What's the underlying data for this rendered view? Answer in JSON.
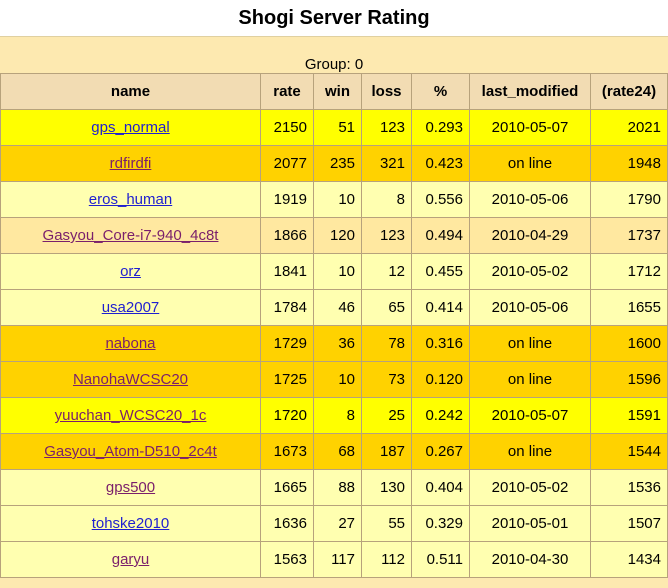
{
  "page": {
    "title": "Shogi Server Rating",
    "group_caption": "Group: 0"
  },
  "table": {
    "headers": {
      "name": "name",
      "rate": "rate",
      "win": "win",
      "loss": "loss",
      "percent": "%",
      "last_modified": "last_modified",
      "rate24": "(rate24)"
    },
    "rows": [
      {
        "name": "gps_normal",
        "rate": "2150",
        "win": "51",
        "loss": "123",
        "percent": "0.293",
        "last_modified": "2010-05-07",
        "rate24": "2021",
        "row_color": "#ffff00",
        "link_visited": false
      },
      {
        "name": "rdfirdfi",
        "rate": "2077",
        "win": "235",
        "loss": "321",
        "percent": "0.423",
        "last_modified": "on line",
        "rate24": "1948",
        "row_color": "#ffd200",
        "link_visited": true
      },
      {
        "name": "eros_human",
        "rate": "1919",
        "win": "10",
        "loss": "8",
        "percent": "0.556",
        "last_modified": "2010-05-06",
        "rate24": "1790",
        "row_color": "#ffffb0",
        "link_visited": false
      },
      {
        "name": "Gasyou_Core-i7-940_4c8t",
        "rate": "1866",
        "win": "120",
        "loss": "123",
        "percent": "0.494",
        "last_modified": "2010-04-29",
        "rate24": "1737",
        "row_color": "#ffe8a0",
        "link_visited": true
      },
      {
        "name": "orz",
        "rate": "1841",
        "win": "10",
        "loss": "12",
        "percent": "0.455",
        "last_modified": "2010-05-02",
        "rate24": "1712",
        "row_color": "#ffffb0",
        "link_visited": false
      },
      {
        "name": "usa2007",
        "rate": "1784",
        "win": "46",
        "loss": "65",
        "percent": "0.414",
        "last_modified": "2010-05-06",
        "rate24": "1655",
        "row_color": "#ffffb0",
        "link_visited": false
      },
      {
        "name": "nabona",
        "rate": "1729",
        "win": "36",
        "loss": "78",
        "percent": "0.316",
        "last_modified": "on line",
        "rate24": "1600",
        "row_color": "#ffd200",
        "link_visited": true
      },
      {
        "name": "NanohaWCSC20",
        "rate": "1725",
        "win": "10",
        "loss": "73",
        "percent": "0.120",
        "last_modified": "on line",
        "rate24": "1596",
        "row_color": "#ffd200",
        "link_visited": true
      },
      {
        "name": "yuuchan_WCSC20_1c",
        "rate": "1720",
        "win": "8",
        "loss": "25",
        "percent": "0.242",
        "last_modified": "2010-05-07",
        "rate24": "1591",
        "row_color": "#ffff00",
        "link_visited": true
      },
      {
        "name": "Gasyou_Atom-D510_2c4t",
        "rate": "1673",
        "win": "68",
        "loss": "187",
        "percent": "0.267",
        "last_modified": "on line",
        "rate24": "1544",
        "row_color": "#ffd200",
        "link_visited": true
      },
      {
        "name": "gps500",
        "rate": "1665",
        "win": "88",
        "loss": "130",
        "percent": "0.404",
        "last_modified": "2010-05-02",
        "rate24": "1536",
        "row_color": "#ffffb0",
        "link_visited": true
      },
      {
        "name": "tohske2010",
        "rate": "1636",
        "win": "27",
        "loss": "55",
        "percent": "0.329",
        "last_modified": "2010-05-01",
        "rate24": "1507",
        "row_color": "#ffffb0",
        "link_visited": false
      },
      {
        "name": "garyu",
        "rate": "1563",
        "win": "117",
        "loss": "112",
        "percent": "0.511",
        "last_modified": "2010-04-30",
        "rate24": "1434",
        "row_color": "#ffffb0",
        "link_visited": true
      }
    ]
  },
  "colors": {
    "page_background": "#fde9b0",
    "header_background": "#f2dcb3",
    "link_unvisited": "#1f1fd0",
    "link_visited": "#7a1f6b"
  }
}
